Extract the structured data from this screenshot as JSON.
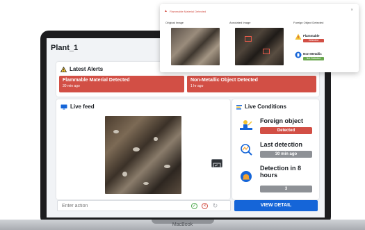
{
  "plant": {
    "title": "Plant_1"
  },
  "alerts": {
    "title": "Latest Alerts",
    "items": [
      {
        "title": "Flammable Material Detected",
        "time": "30 min ago"
      },
      {
        "title": "Non-Metallic Object Detected",
        "time": "1 hr ago"
      }
    ]
  },
  "live_feed": {
    "title": "Live feed"
  },
  "conditions": {
    "title": "Live Conditions",
    "items": [
      {
        "label": "Foreign object",
        "value": "Detected",
        "color": "#d24f45",
        "icon": "worker-excavator-icon"
      },
      {
        "label": "Last detection",
        "value": "30 min ago",
        "color": "#8e9196",
        "icon": "magnifier-graph-icon"
      },
      {
        "label": "Detection in 8 hours",
        "value": "3",
        "color": "#8e9196",
        "icon": "alarm-bell-icon"
      }
    ]
  },
  "action": {
    "placeholder": "Enter action",
    "view_detail": "VIEW DETAIL"
  },
  "popup": {
    "title": "Flammable Material Detected",
    "close": "×",
    "original_title": "Original Image",
    "annotated_title": "Annotated Image",
    "foreign_title": "Foreign Object Detected",
    "objects": [
      {
        "name": "Flammable",
        "status": "Detected",
        "color": "#d24f45",
        "icon": "flame-warning-icon"
      },
      {
        "name": "Non-Metallic",
        "status": "Not Detected",
        "color": "#6aa84f",
        "icon": "bottle-icon"
      }
    ]
  },
  "laptop": {
    "brand": "MacBook"
  },
  "colors": {
    "alert": "#d24f45",
    "primary": "#1565d8",
    "muted": "#8e9196",
    "ok": "#6aa84f"
  }
}
